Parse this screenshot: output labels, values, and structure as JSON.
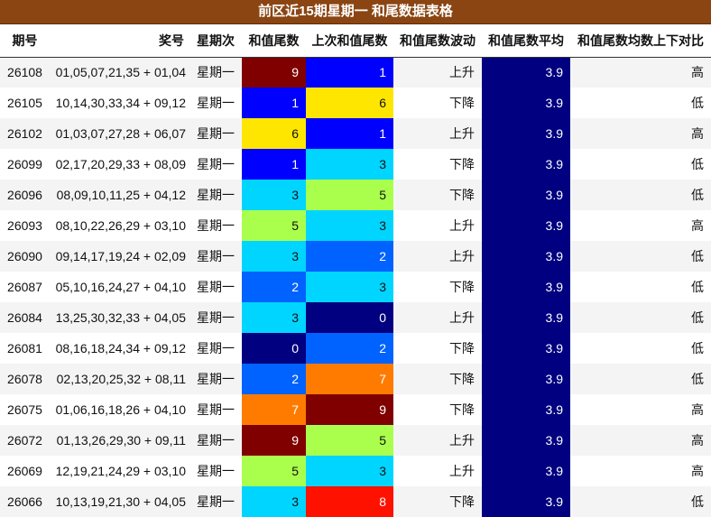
{
  "title": "前区近15期星期一 和尾数据表格",
  "headers": [
    "期号",
    "奖号",
    "星期次",
    "和值尾数",
    "上次和值尾数",
    "和值尾数波动",
    "和值尾数平均",
    "和值尾数均数上下对比"
  ],
  "colors": {
    "tail_0": "#000080",
    "tail_1": "#0000ff",
    "tail_2": "#0062ff",
    "tail_3": "#00d5ff",
    "tail_5": "#aaff4d",
    "tail_6": "#ffe600",
    "tail_7": "#ff7b00",
    "tail_8": "#ff1100",
    "tail_9": "#800000",
    "avg": "#000080"
  },
  "rows": [
    {
      "issue": "26108",
      "numbers": "01,05,07,21,35 + 01,04",
      "day": "星期一",
      "tail": "9",
      "tail_bg": "#800000",
      "tail_fg": "#ffffff",
      "prev": "1",
      "prev_bg": "#0000ff",
      "prev_fg": "#ffffff",
      "trend": "上升",
      "avg": "3.9",
      "cmp": "高"
    },
    {
      "issue": "26105",
      "numbers": "10,14,30,33,34 + 09,12",
      "day": "星期一",
      "tail": "1",
      "tail_bg": "#0000ff",
      "tail_fg": "#ffffff",
      "prev": "6",
      "prev_bg": "#ffe600",
      "prev_fg": "#111111",
      "trend": "下降",
      "avg": "3.9",
      "cmp": "低"
    },
    {
      "issue": "26102",
      "numbers": "01,03,07,27,28 + 06,07",
      "day": "星期一",
      "tail": "6",
      "tail_bg": "#ffe600",
      "tail_fg": "#111111",
      "prev": "1",
      "prev_bg": "#0000ff",
      "prev_fg": "#ffffff",
      "trend": "上升",
      "avg": "3.9",
      "cmp": "高"
    },
    {
      "issue": "26099",
      "numbers": "02,17,20,29,33 + 08,09",
      "day": "星期一",
      "tail": "1",
      "tail_bg": "#0000ff",
      "tail_fg": "#ffffff",
      "prev": "3",
      "prev_bg": "#00d5ff",
      "prev_fg": "#111111",
      "trend": "下降",
      "avg": "3.9",
      "cmp": "低"
    },
    {
      "issue": "26096",
      "numbers": "08,09,10,11,25 + 04,12",
      "day": "星期一",
      "tail": "3",
      "tail_bg": "#00d5ff",
      "tail_fg": "#111111",
      "prev": "5",
      "prev_bg": "#aaff4d",
      "prev_fg": "#111111",
      "trend": "下降",
      "avg": "3.9",
      "cmp": "低"
    },
    {
      "issue": "26093",
      "numbers": "08,10,22,26,29 + 03,10",
      "day": "星期一",
      "tail": "5",
      "tail_bg": "#aaff4d",
      "tail_fg": "#111111",
      "prev": "3",
      "prev_bg": "#00d5ff",
      "prev_fg": "#111111",
      "trend": "上升",
      "avg": "3.9",
      "cmp": "高"
    },
    {
      "issue": "26090",
      "numbers": "09,14,17,19,24 + 02,09",
      "day": "星期一",
      "tail": "3",
      "tail_bg": "#00d5ff",
      "tail_fg": "#111111",
      "prev": "2",
      "prev_bg": "#0062ff",
      "prev_fg": "#ffffff",
      "trend": "上升",
      "avg": "3.9",
      "cmp": "低"
    },
    {
      "issue": "26087",
      "numbers": "05,10,16,24,27 + 04,10",
      "day": "星期一",
      "tail": "2",
      "tail_bg": "#0062ff",
      "tail_fg": "#ffffff",
      "prev": "3",
      "prev_bg": "#00d5ff",
      "prev_fg": "#111111",
      "trend": "下降",
      "avg": "3.9",
      "cmp": "低"
    },
    {
      "issue": "26084",
      "numbers": "13,25,30,32,33 + 04,05",
      "day": "星期一",
      "tail": "3",
      "tail_bg": "#00d5ff",
      "tail_fg": "#111111",
      "prev": "0",
      "prev_bg": "#000080",
      "prev_fg": "#ffffff",
      "trend": "上升",
      "avg": "3.9",
      "cmp": "低"
    },
    {
      "issue": "26081",
      "numbers": "08,16,18,24,34 + 09,12",
      "day": "星期一",
      "tail": "0",
      "tail_bg": "#000080",
      "tail_fg": "#ffffff",
      "prev": "2",
      "prev_bg": "#0062ff",
      "prev_fg": "#ffffff",
      "trend": "下降",
      "avg": "3.9",
      "cmp": "低"
    },
    {
      "issue": "26078",
      "numbers": "02,13,20,25,32 + 08,11",
      "day": "星期一",
      "tail": "2",
      "tail_bg": "#0062ff",
      "tail_fg": "#ffffff",
      "prev": "7",
      "prev_bg": "#ff7b00",
      "prev_fg": "#ffffff",
      "trend": "下降",
      "avg": "3.9",
      "cmp": "低"
    },
    {
      "issue": "26075",
      "numbers": "01,06,16,18,26 + 04,10",
      "day": "星期一",
      "tail": "7",
      "tail_bg": "#ff7b00",
      "tail_fg": "#ffffff",
      "prev": "9",
      "prev_bg": "#800000",
      "prev_fg": "#ffffff",
      "trend": "下降",
      "avg": "3.9",
      "cmp": "高"
    },
    {
      "issue": "26072",
      "numbers": "01,13,26,29,30 + 09,11",
      "day": "星期一",
      "tail": "9",
      "tail_bg": "#800000",
      "tail_fg": "#ffffff",
      "prev": "5",
      "prev_bg": "#aaff4d",
      "prev_fg": "#111111",
      "trend": "上升",
      "avg": "3.9",
      "cmp": "高"
    },
    {
      "issue": "26069",
      "numbers": "12,19,21,24,29 + 03,10",
      "day": "星期一",
      "tail": "5",
      "tail_bg": "#aaff4d",
      "tail_fg": "#111111",
      "prev": "3",
      "prev_bg": "#00d5ff",
      "prev_fg": "#111111",
      "trend": "上升",
      "avg": "3.9",
      "cmp": "高"
    },
    {
      "issue": "26066",
      "numbers": "10,13,19,21,30 + 04,05",
      "day": "星期一",
      "tail": "3",
      "tail_bg": "#00d5ff",
      "tail_fg": "#111111",
      "prev": "8",
      "prev_bg": "#ff1100",
      "prev_fg": "#ffffff",
      "trend": "下降",
      "avg": "3.9",
      "cmp": "低"
    }
  ]
}
